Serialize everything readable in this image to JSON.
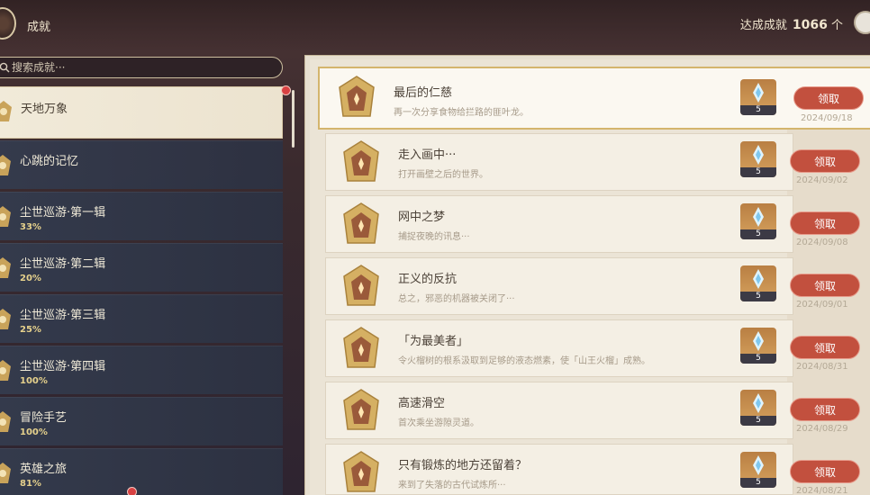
{
  "header": {
    "title": "成就",
    "summary_label": "达成成就",
    "summary_count": "1066",
    "summary_unit": "个"
  },
  "search": {
    "placeholder": "搜索成就···"
  },
  "categories": [
    {
      "name": "天地万象",
      "pct": ""
    },
    {
      "name": "心跳的记忆",
      "pct": ""
    },
    {
      "name": "尘世巡游·第一辑",
      "pct": "33%"
    },
    {
      "name": "尘世巡游·第二辑",
      "pct": "20%"
    },
    {
      "name": "尘世巡游·第三辑",
      "pct": "25%"
    },
    {
      "name": "尘世巡游·第四辑",
      "pct": "100%"
    },
    {
      "name": "冒险手艺",
      "pct": "100%"
    },
    {
      "name": "英雄之旅",
      "pct": "81%"
    }
  ],
  "achievements": [
    {
      "title": "最后的仁慈",
      "desc": "再一次分享食物给拦路的匪叶龙。",
      "reward": "5",
      "claim": "领取",
      "date": "2024/09/18"
    },
    {
      "title": "走入画中···",
      "desc": "打开画壁之后的世界。",
      "reward": "5",
      "claim": "领取",
      "date": "2024/09/02"
    },
    {
      "title": "网中之梦",
      "desc": "捕捉夜晚的讯息···",
      "reward": "5",
      "claim": "领取",
      "date": "2024/09/08"
    },
    {
      "title": "正义的反抗",
      "desc": "总之，邪恶的机器被关闭了···",
      "reward": "5",
      "claim": "领取",
      "date": "2024/09/01"
    },
    {
      "title": "「为最美者」",
      "desc": "令火榴树的根系汲取到足够的液态燃素，使「山王火榴」成熟。",
      "reward": "5",
      "claim": "领取",
      "date": "2024/08/31"
    },
    {
      "title": "高速滑空",
      "desc": "首次乘坐游隙灵道。",
      "reward": "5",
      "claim": "领取",
      "date": "2024/08/29"
    },
    {
      "title": "只有锻炼的地方还留着？",
      "desc": "来到了失落的古代试炼所···",
      "reward": "5",
      "claim": "领取",
      "date": "2024/08/21"
    }
  ],
  "colors": {
    "accent_gold": "#d4b56d",
    "claim_red": "#c2503e",
    "category_bg": "#343c4e"
  }
}
